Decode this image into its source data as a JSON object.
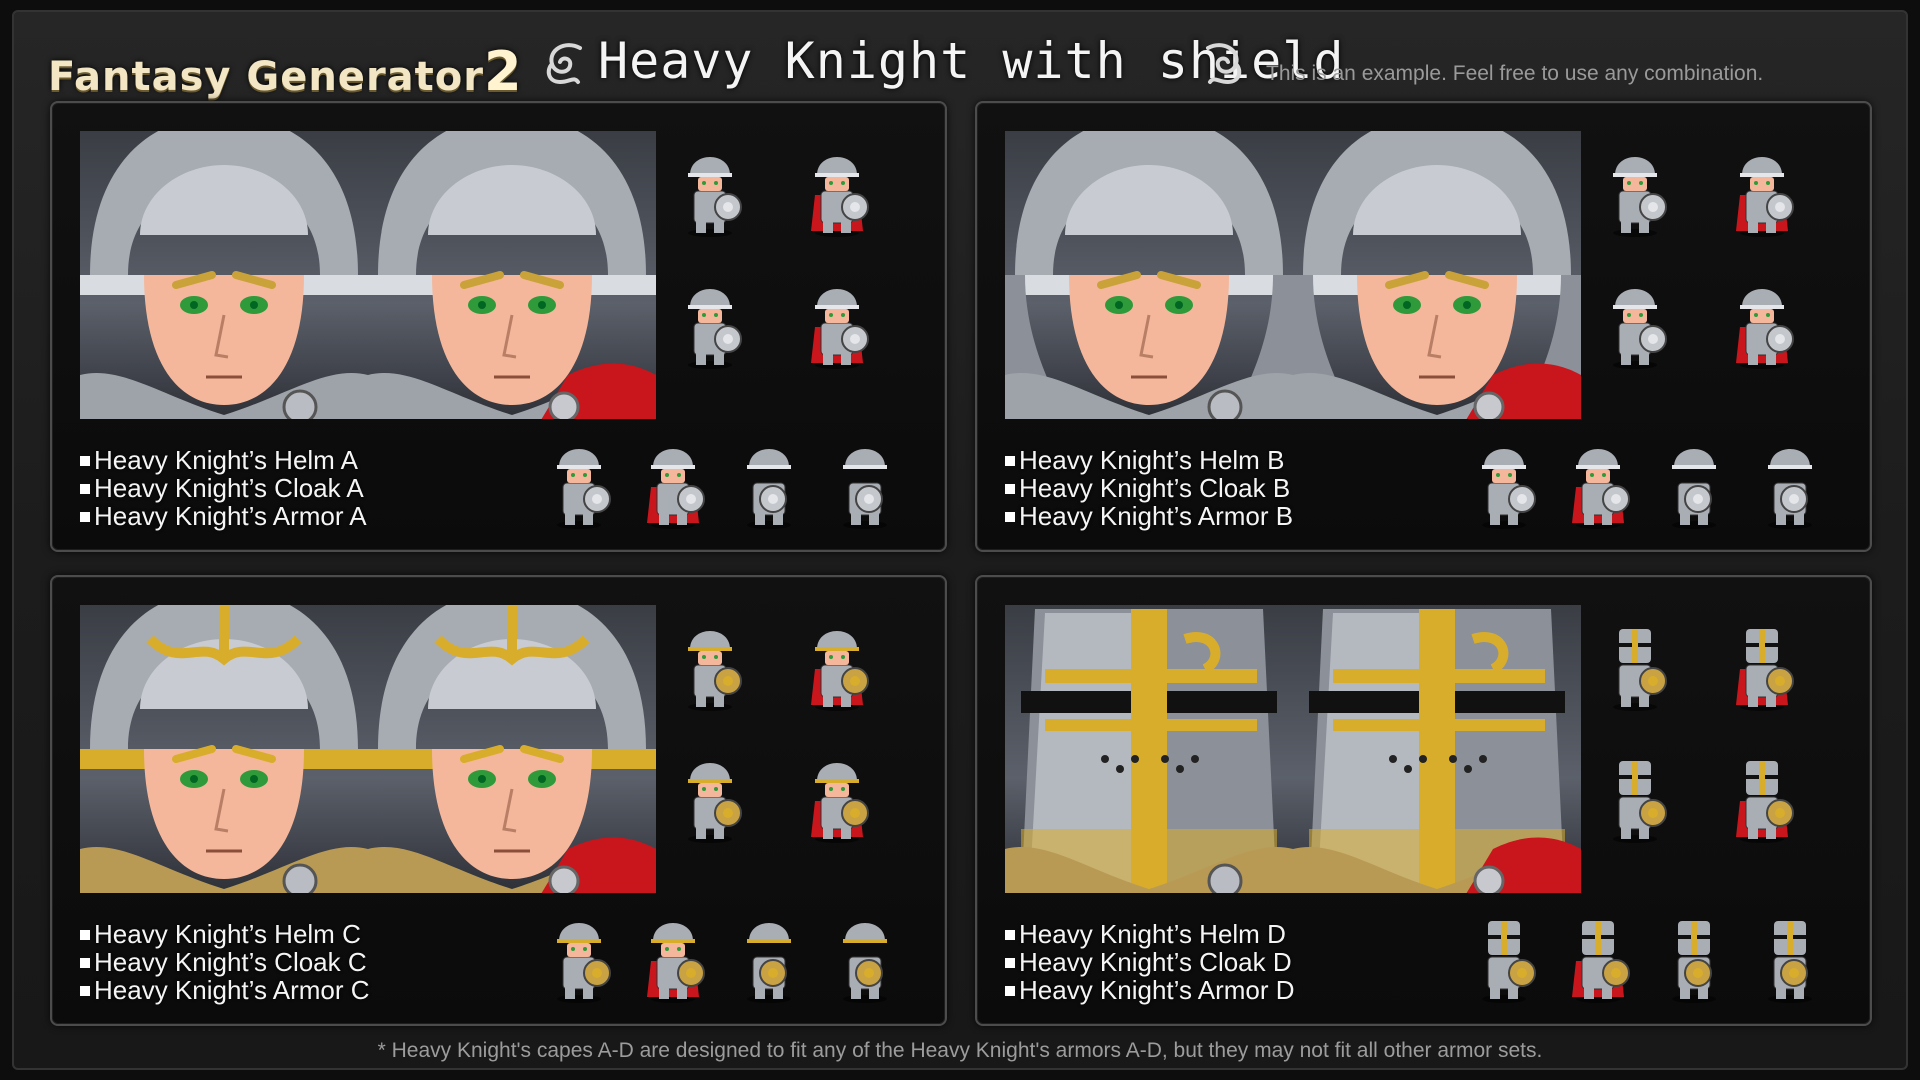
{
  "header": {
    "brand": "Fantasy Generator",
    "brand_num": "2",
    "title": "Heavy Knight with shield",
    "note": "This is an example. Feel free to use any combination."
  },
  "colors": {
    "silver": "#9aa0a8",
    "gold": "#d9ad2c",
    "red": "#c8161c",
    "skin": "#f4b79b",
    "eyes": "#2f9a3a"
  },
  "panels": [
    {
      "variant": "A",
      "items": [
        "Heavy Knight’s Helm A",
        "Heavy Knight’s Cloak A",
        "Heavy Knight’s Armor A"
      ]
    },
    {
      "variant": "B",
      "items": [
        "Heavy Knight’s Helm B",
        "Heavy Knight’s Cloak B",
        "Heavy Knight’s Armor B"
      ]
    },
    {
      "variant": "C",
      "items": [
        "Heavy Knight’s Helm C",
        "Heavy Knight’s Cloak C",
        "Heavy Knight’s Armor C"
      ]
    },
    {
      "variant": "D",
      "items": [
        "Heavy Knight’s Helm D",
        "Heavy Knight’s Cloak D",
        "Heavy Knight’s Armor D"
      ]
    }
  ],
  "footer": "* Heavy Knight's capes A-D are designed to fit any of the Heavy Knight's armors A-D, but they may not fit all other armor sets."
}
